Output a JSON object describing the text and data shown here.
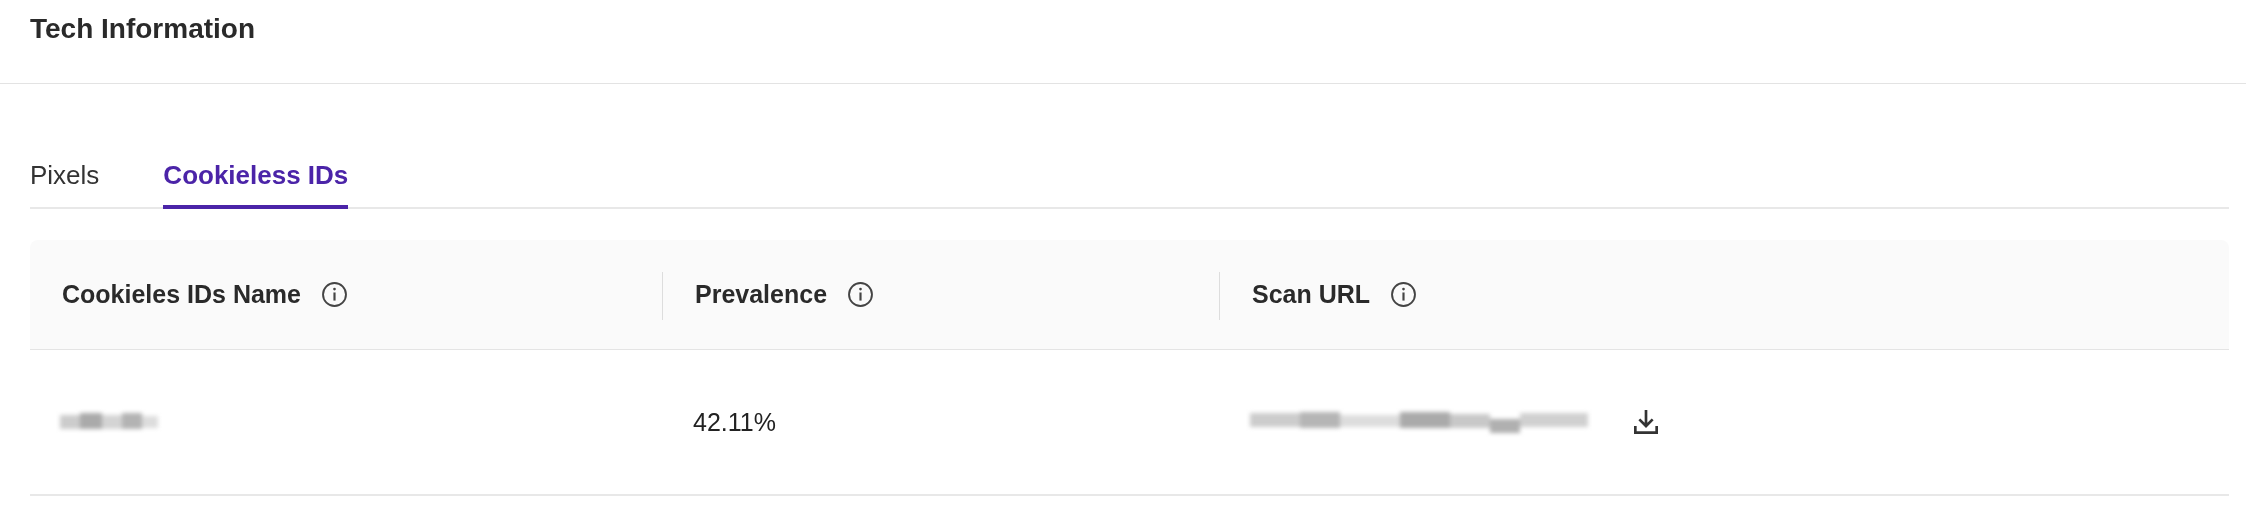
{
  "header": {
    "title": "Tech Information"
  },
  "tabs": [
    {
      "label": "Pixels",
      "selected": false
    },
    {
      "label": "Cookieless IDs",
      "selected": true
    }
  ],
  "table": {
    "columns": [
      "Cookieles IDs Name",
      "Prevalence",
      "Scan URL"
    ],
    "rows": [
      {
        "prevalence": "42.11%"
      }
    ]
  }
}
